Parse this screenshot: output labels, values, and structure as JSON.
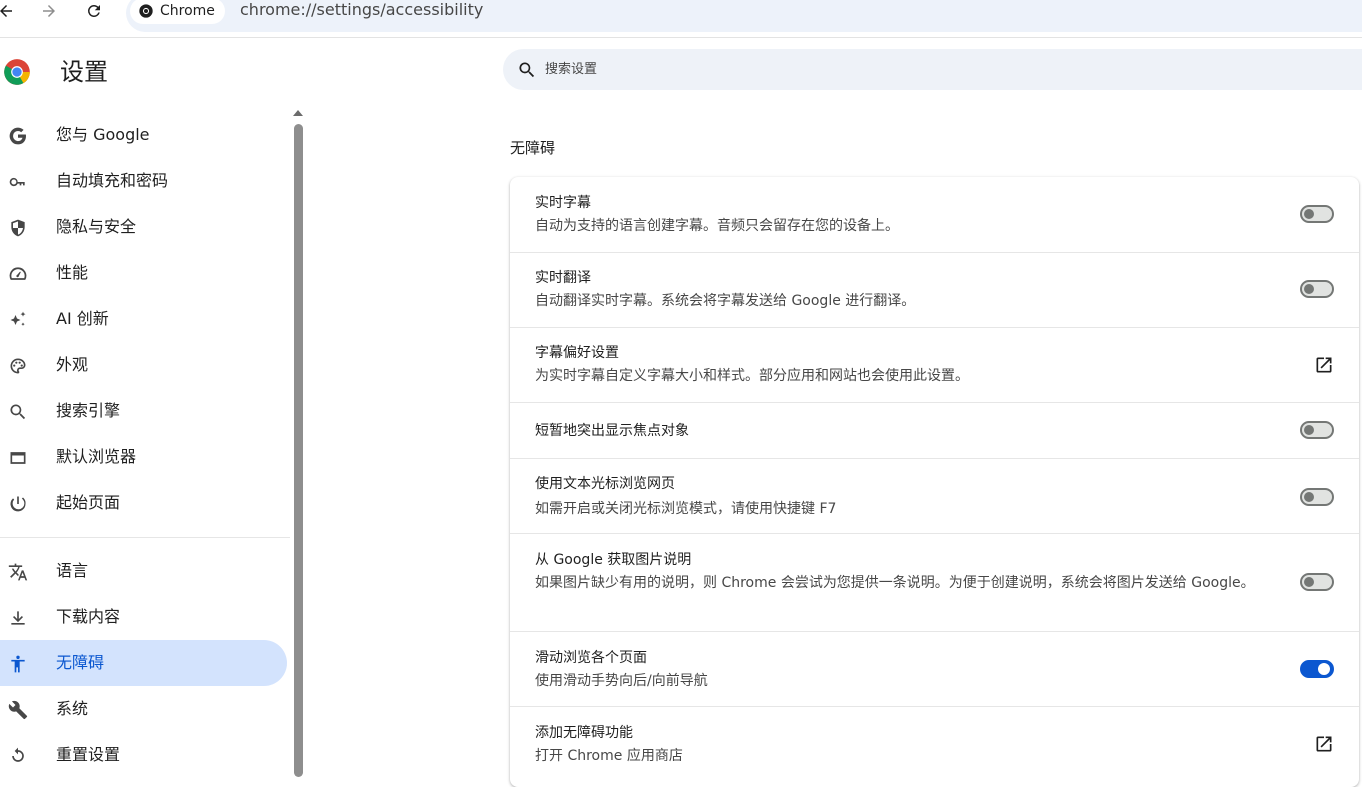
{
  "browser": {
    "chip_label": "Chrome",
    "url": "chrome://settings/accessibility"
  },
  "header": {
    "title": "设置",
    "search_placeholder": "搜索设置"
  },
  "sidebar": {
    "items": [
      {
        "label": "您与 Google",
        "icon": "google-icon"
      },
      {
        "label": "自动填充和密码",
        "icon": "key-icon"
      },
      {
        "label": "隐私与安全",
        "icon": "shield-icon"
      },
      {
        "label": "性能",
        "icon": "speedometer-icon"
      },
      {
        "label": "AI 创新",
        "icon": "sparkle-icon"
      },
      {
        "label": "外观",
        "icon": "palette-icon"
      },
      {
        "label": "搜索引擎",
        "icon": "search-icon"
      },
      {
        "label": "默认浏览器",
        "icon": "browser-window-icon"
      },
      {
        "label": "起始页面",
        "icon": "power-icon"
      },
      {
        "label": "语言",
        "icon": "translate-icon"
      },
      {
        "label": "下载内容",
        "icon": "download-icon"
      },
      {
        "label": "无障碍",
        "icon": "accessibility-icon",
        "active": true
      },
      {
        "label": "系统",
        "icon": "wrench-icon"
      },
      {
        "label": "重置设置",
        "icon": "reset-icon"
      }
    ]
  },
  "main": {
    "section_title": "无障碍",
    "rows": [
      {
        "title": "实时字幕",
        "subtitle": "自动为支持的语言创建字幕。音频只会留存在您的设备上。",
        "control": "toggle",
        "on": false
      },
      {
        "title": "实时翻译",
        "subtitle": "自动翻译实时字幕。系统会将字幕发送给 Google 进行翻译。",
        "control": "toggle",
        "on": false
      },
      {
        "title": "字幕偏好设置",
        "subtitle": "为实时字幕自定义字幕大小和样式。部分应用和网站也会使用此设置。",
        "control": "external-link"
      },
      {
        "title": "短暂地突出显示焦点对象",
        "subtitle": "",
        "control": "toggle",
        "on": false
      },
      {
        "title": "使用文本光标浏览网页",
        "subtitle": "如需开启或关闭光标浏览模式，请使用快捷键 F7",
        "control": "toggle",
        "on": false
      },
      {
        "title": "从 Google 获取图片说明",
        "subtitle": "如果图片缺少有用的说明，则 Chrome 会尝试为您提供一条说明。为便于创建说明，系统会将图片发送给 Google。",
        "control": "toggle",
        "on": false
      },
      {
        "title": "滑动浏览各个页面",
        "subtitle": "使用滑动手势向后/向前导航",
        "control": "toggle",
        "on": true
      },
      {
        "title": "添加无障碍功能",
        "subtitle": "打开 Chrome 应用商店",
        "control": "external-link"
      }
    ]
  },
  "colors": {
    "accent": "#0b57d0",
    "active_nav_bg": "#d3e3fd",
    "search_bg": "#eef2f8"
  }
}
